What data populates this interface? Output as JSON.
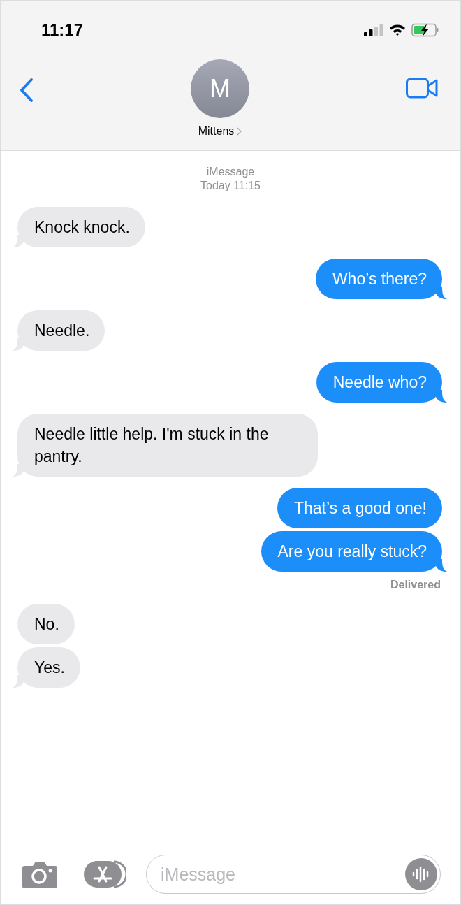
{
  "status_bar": {
    "time": "11:17"
  },
  "contact": {
    "initial": "M",
    "name": "Mittens"
  },
  "thread_header": {
    "service": "iMessage",
    "timestamp": "Today 11:15"
  },
  "messages": [
    {
      "kind": "received",
      "text": "Knock knock.",
      "tail": true
    },
    {
      "kind": "sent",
      "text": "Who’s there?",
      "tail": true
    },
    {
      "kind": "received",
      "text": "Needle.",
      "tail": true
    },
    {
      "kind": "sent",
      "text": "Needle who?",
      "tail": true
    },
    {
      "kind": "received",
      "text": "Needle little help. I'm stuck in the pantry.",
      "tail": true
    },
    {
      "kind": "sent",
      "text": "That’s a good one!",
      "tail": false
    },
    {
      "kind": "sent",
      "text": "Are you really stuck?",
      "tail": true,
      "receipt": "Delivered"
    },
    {
      "kind": "received",
      "text": "No.",
      "tail": false
    },
    {
      "kind": "received",
      "text": "Yes.",
      "tail": true
    }
  ],
  "composer": {
    "placeholder": "iMessage"
  }
}
